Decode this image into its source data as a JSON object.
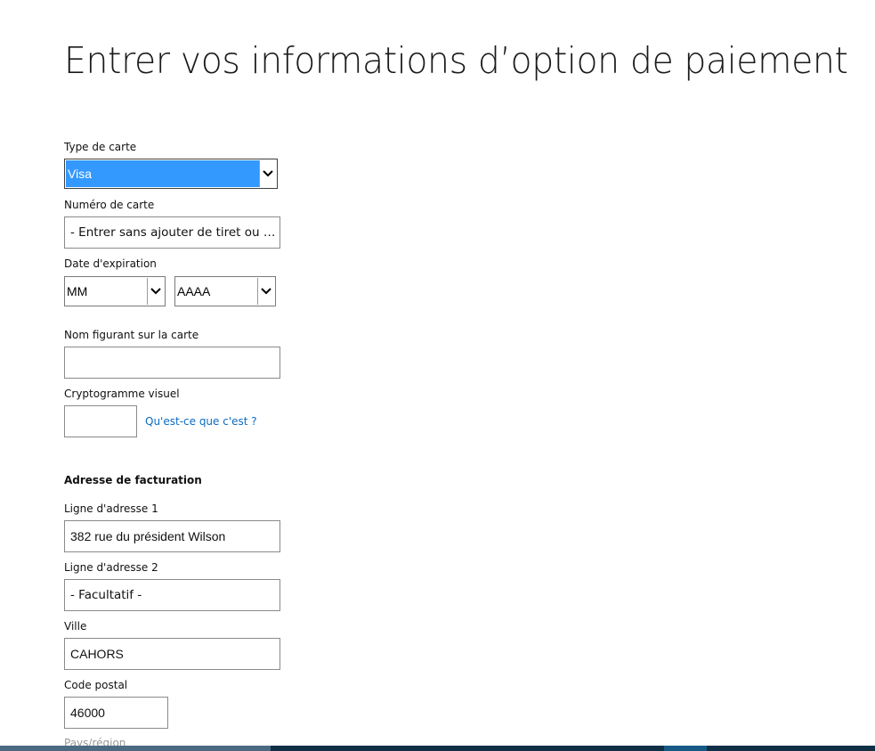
{
  "page": {
    "title": "Entrer vos informations d’option de paiement"
  },
  "card": {
    "type_label": "Type de carte",
    "type_value": "Visa",
    "number_label": "Numéro de carte",
    "number_placeholder": "- Entrer sans ajouter de tiret ou d'e...",
    "expiry_label": "Date d'expiration",
    "expiry_month_value": "MM",
    "expiry_year_value": "AAAA",
    "name_label": "Nom figurant sur la carte",
    "name_value": "",
    "cvv_label": "Cryptogramme visuel",
    "cvv_value": "",
    "cvv_help_link": "Qu'est-ce que c'est ?"
  },
  "billing": {
    "heading": "Adresse de facturation",
    "address1_label": "Ligne d'adresse 1",
    "address1_value": "382 rue du président Wilson",
    "address2_label": "Ligne d'adresse 2",
    "address2_placeholder": "- Facultatif -",
    "city_label": "Ville",
    "city_value": "CAHORS",
    "postal_label": "Code postal",
    "postal_value": "46000",
    "country_label": "Pays/région"
  },
  "icons": {
    "dropdown": "chevron-down-icon"
  }
}
